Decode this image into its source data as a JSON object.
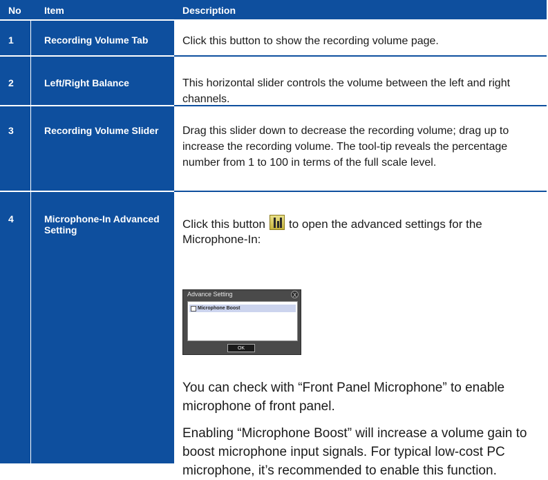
{
  "header": {
    "no": "No",
    "item": "Item",
    "description": "Description"
  },
  "rows": [
    {
      "no": "1",
      "item": "Recording Volume Tab",
      "description": "Click this button to show the recording volume page."
    },
    {
      "no": "2",
      "item": "Left/Right Balance",
      "description": "This horizontal slider controls the volume between the left and right channels."
    },
    {
      "no": "3",
      "item": "Recording Volume Slider",
      "description": "Drag this slider down to decrease the recording volume; drag up to increase the recording volume. The tool-tip reveals the percentage number from 1 to 100 in terms of the full scale level."
    },
    {
      "no": "4",
      "item": "Microphone-In Advanced Setting",
      "desc_before_icon": "Click this button",
      "desc_after_icon": "to open the advanced settings for the Microphone-In:",
      "paragraph_2": "You can check with “Front Panel Microphone” to enable microphone of front panel.",
      "paragraph_3": "Enabling “Microphone Boost” will increase a volume gain to boost microphone input signals. For typical low-cost PC microphone, it’s recommended to  enable this function."
    }
  ],
  "dialog": {
    "title": "Advance Setting",
    "close_glyph": "X",
    "option_label": "Microphone Boost",
    "ok_label": "OK"
  },
  "colors": {
    "header_blue": "#0e4f9e",
    "text_white": "#ffffff"
  }
}
